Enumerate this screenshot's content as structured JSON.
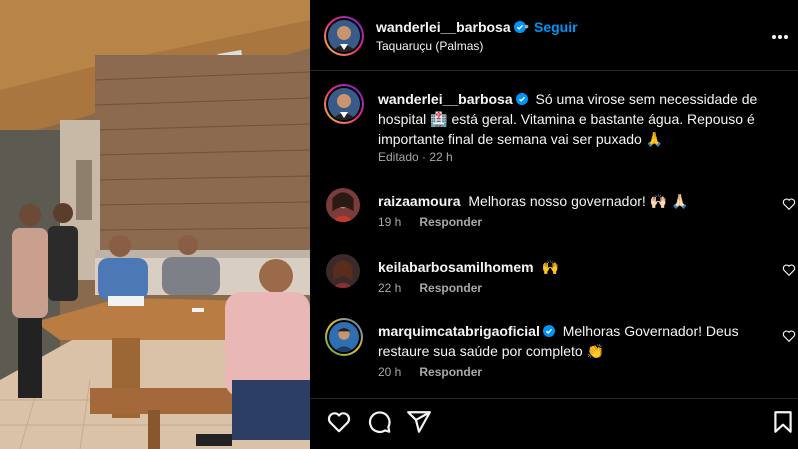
{
  "post": {
    "author": "wanderlei__barbosa",
    "follow_label": "Seguir",
    "separator": "•",
    "location": "Taquaruçu (Palmas)",
    "more_icon": "more-options-icon"
  },
  "caption": {
    "username": "wanderlei__barbosa",
    "text": "Só uma virose sem necessidade de hospital 🏥 está geral. Vitamina e bastante água. Repouso é importante final de semana vai ser puxado 🙏",
    "edited_label": "Editado",
    "time": "22 h"
  },
  "comments": [
    {
      "username": "raizaamoura",
      "text": "Melhoras nosso governador! 🙌🏻 🙏🏻",
      "time": "19 h",
      "reply_label": "Responder",
      "verified": false
    },
    {
      "username": "keilabarbosamilhomem",
      "text": "🙌",
      "time": "22 h",
      "reply_label": "Responder",
      "verified": false
    },
    {
      "username": "marquimcatabrigaoficial",
      "text": "Melhoras Governador! Deus restaure sua saúde por completo 👏",
      "time": "20 h",
      "reply_label": "Responder",
      "verified": true
    }
  ],
  "actions": [
    "like-icon",
    "comment-icon",
    "share-icon",
    "save-icon"
  ],
  "colors": {
    "background": "#000000",
    "primary_text": "#f5f5f5",
    "secondary_text": "#a8a8a8",
    "follow_blue": "#0095f6",
    "verified_blue": "#0095f6"
  }
}
